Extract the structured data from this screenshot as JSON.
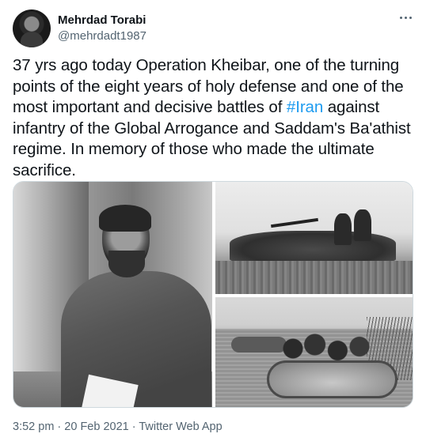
{
  "tweet": {
    "author": {
      "display_name": "Mehrdad Torabi",
      "handle": "@mehrdadt1987"
    },
    "text_parts": {
      "before_hashtag": "37 yrs ago today Operation Kheibar, one of the turning points of the eight years of holy defense and one of the most important and decisive battles of ",
      "hashtag": "#Iran",
      "after_hashtag": " against infantry of the Global Arrogance and Saddam's Ba'athist regime. In memory of those who made the ultimate sacrifice."
    },
    "footer": {
      "time": "3:52 pm",
      "separator1": " · ",
      "date": "20 Feb 2021",
      "separator2": " · ",
      "source": "Twitter Web App"
    }
  },
  "icons": {
    "more": "more-dots-icon"
  },
  "colors": {
    "text": "#0f1419",
    "secondary": "#536471",
    "link": "#1d9bf0",
    "border": "#cfd9de"
  }
}
